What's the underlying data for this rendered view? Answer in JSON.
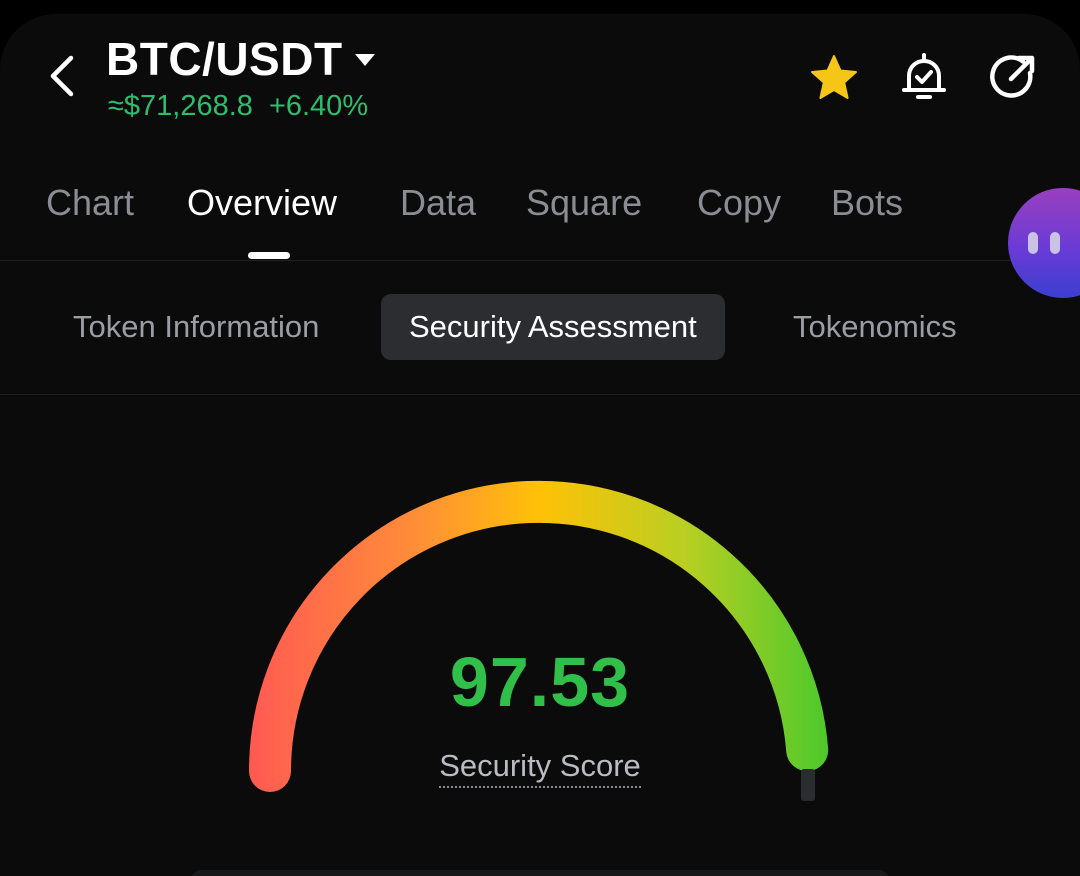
{
  "header": {
    "back_icon": "chevron-left-icon",
    "pair": "BTC/USDT",
    "pair_dropdown_icon": "caret-down-icon",
    "price": "≈$71,268.8",
    "change": "+6.40%",
    "price_color": "#2ebd6e",
    "icons": {
      "favorite": "star-icon",
      "alert": "bell-check-icon",
      "share": "share-arrow-icon"
    },
    "favorite_color": "#f5c518"
  },
  "main_tabs": [
    {
      "label": "Chart",
      "active": false
    },
    {
      "label": "Overview",
      "active": true
    },
    {
      "label": "Data",
      "active": false
    },
    {
      "label": "Square",
      "active": false
    },
    {
      "label": "Copy",
      "active": false
    },
    {
      "label": "Bots",
      "active": false
    }
  ],
  "sub_tabs": [
    {
      "label": "Token Information",
      "active": false
    },
    {
      "label": "Security Assessment",
      "active": true
    },
    {
      "label": "Tokenomics",
      "active": false
    }
  ],
  "security": {
    "score": "97.53",
    "score_fraction": 0.9753,
    "label": "Security Score",
    "score_color": "#30c04a",
    "gauge_colors": [
      "#ff5a52",
      "#ff8a3a",
      "#ffc107",
      "#b9cf22",
      "#4cc82c"
    ]
  },
  "assistant_icon": "assistant-face-icon"
}
